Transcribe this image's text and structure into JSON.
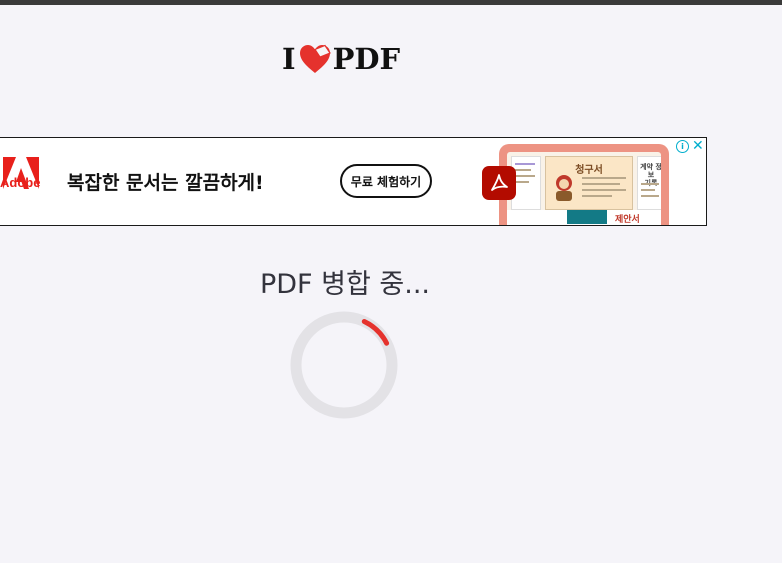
{
  "header": {
    "logo_text_left": "I",
    "logo_text_right": "PDF",
    "logo_icon": "heart-icon"
  },
  "ad": {
    "brand": "Adobe",
    "headline": "복잡한 문서는 깔끔하게!",
    "cta_label": "무료 체험하기",
    "preview_invoice_title": "청구서",
    "preview_side_title": "계약 정보\n기록",
    "preview_proposal": "제안서",
    "close_icon": "close-icon",
    "info_icon": "info-icon"
  },
  "main": {
    "status_text": "PDF 병합 중...",
    "progress_indicator": "loading-spinner"
  },
  "colors": {
    "brand_red": "#e5322d",
    "adobe_red": "#e8201b",
    "acrobat_red": "#b30b00",
    "background": "#f5f4f9",
    "spinner_track": "#e3e2e6"
  }
}
